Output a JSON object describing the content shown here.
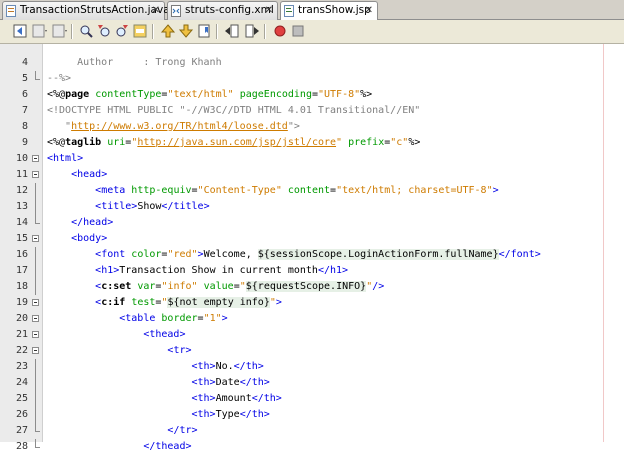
{
  "tabs": [
    {
      "label": "TransactionStrutsAction.java",
      "active": false,
      "icon": "java-file-icon"
    },
    {
      "label": "struts-config.xml",
      "active": false,
      "icon": "xml-file-icon"
    },
    {
      "label": "transShow.jsp",
      "active": true,
      "icon": "jsp-file-icon"
    }
  ],
  "toolbar": {
    "buttons": [
      "last-edit-icon",
      "back-icon",
      "forward-icon",
      "find-selection-icon",
      "find-previous-icon",
      "find-next-icon",
      "toggle-highlight-icon",
      "previous-bookmark-icon",
      "next-bookmark-icon",
      "toggle-bookmark-icon",
      "shift-left-icon",
      "shift-right-icon",
      "start-macro-icon",
      "stop-macro-icon"
    ]
  },
  "editor": {
    "lines": [
      {
        "n": "4",
        "fold": "none",
        "tokens": [
          {
            "c": "t-cmt",
            "t": "     Author     : Trong Khanh"
          }
        ]
      },
      {
        "n": "5",
        "fold": "end",
        "tokens": [
          {
            "c": "t-cmt",
            "t": "--%>"
          }
        ]
      },
      {
        "n": "6",
        "fold": "none",
        "tokens": [
          {
            "c": "t-jsp",
            "t": "<%@"
          },
          {
            "c": "t-dir",
            "t": "page"
          },
          {
            "c": "t-txt",
            "t": " "
          },
          {
            "c": "t-attr",
            "t": "contentType"
          },
          {
            "c": "t-txt",
            "t": "="
          },
          {
            "c": "t-val",
            "t": "\"text/html\""
          },
          {
            "c": "t-txt",
            "t": " "
          },
          {
            "c": "t-attr",
            "t": "pageEncoding"
          },
          {
            "c": "t-txt",
            "t": "="
          },
          {
            "c": "t-val",
            "t": "\"UTF-8\""
          },
          {
            "c": "t-jsp",
            "t": "%>"
          }
        ]
      },
      {
        "n": "7",
        "fold": "none",
        "tokens": [
          {
            "c": "t-doc",
            "t": "<!DOCTYPE HTML PUBLIC \"-//W3C//DTD HTML 4.01 Transitional//EN\""
          }
        ]
      },
      {
        "n": "8",
        "fold": "none",
        "tokens": [
          {
            "c": "t-doc",
            "t": "   \""
          },
          {
            "c": "t-url",
            "t": "http://www.w3.org/TR/html4/loose.dtd"
          },
          {
            "c": "t-doc",
            "t": "\">"
          }
        ]
      },
      {
        "n": "9",
        "fold": "none",
        "tokens": [
          {
            "c": "t-jsp",
            "t": "<%@"
          },
          {
            "c": "t-dir",
            "t": "taglib"
          },
          {
            "c": "t-txt",
            "t": " "
          },
          {
            "c": "t-attr",
            "t": "uri"
          },
          {
            "c": "t-txt",
            "t": "="
          },
          {
            "c": "t-val",
            "t": "\""
          },
          {
            "c": "t-url",
            "t": "http://java.sun.com/jsp/jstl/core"
          },
          {
            "c": "t-val",
            "t": "\""
          },
          {
            "c": "t-txt",
            "t": " "
          },
          {
            "c": "t-attr",
            "t": "prefix"
          },
          {
            "c": "t-txt",
            "t": "="
          },
          {
            "c": "t-val",
            "t": "\"c\""
          },
          {
            "c": "t-jsp",
            "t": "%>"
          }
        ]
      },
      {
        "n": "10",
        "fold": "open",
        "tokens": [
          {
            "c": "t-tag",
            "t": "<html>"
          }
        ]
      },
      {
        "n": "11",
        "fold": "open",
        "tokens": [
          {
            "c": "t-txt",
            "t": "    "
          },
          {
            "c": "t-tag",
            "t": "<head>"
          }
        ]
      },
      {
        "n": "12",
        "fold": "line",
        "tokens": [
          {
            "c": "t-txt",
            "t": "        "
          },
          {
            "c": "t-tag",
            "t": "<meta "
          },
          {
            "c": "t-attr",
            "t": "http-equiv"
          },
          {
            "c": "t-txt",
            "t": "="
          },
          {
            "c": "t-val",
            "t": "\"Content-Type\""
          },
          {
            "c": "t-txt",
            "t": " "
          },
          {
            "c": "t-attr",
            "t": "content"
          },
          {
            "c": "t-txt",
            "t": "="
          },
          {
            "c": "t-val",
            "t": "\"text/html; charset=UTF-8\""
          },
          {
            "c": "t-tag",
            "t": ">"
          }
        ]
      },
      {
        "n": "13",
        "fold": "line",
        "tokens": [
          {
            "c": "t-txt",
            "t": "        "
          },
          {
            "c": "t-tag",
            "t": "<title>"
          },
          {
            "c": "t-txt",
            "t": "Show"
          },
          {
            "c": "t-tag",
            "t": "</title>"
          }
        ]
      },
      {
        "n": "14",
        "fold": "end",
        "tokens": [
          {
            "c": "t-txt",
            "t": "    "
          },
          {
            "c": "t-tag",
            "t": "</head>"
          }
        ]
      },
      {
        "n": "15",
        "fold": "open",
        "tokens": [
          {
            "c": "t-txt",
            "t": "    "
          },
          {
            "c": "t-tag",
            "t": "<body>"
          }
        ]
      },
      {
        "n": "16",
        "fold": "line",
        "tokens": [
          {
            "c": "t-txt",
            "t": "        "
          },
          {
            "c": "t-tag",
            "t": "<font "
          },
          {
            "c": "t-attr",
            "t": "color"
          },
          {
            "c": "t-txt",
            "t": "="
          },
          {
            "c": "t-val",
            "t": "\"red\""
          },
          {
            "c": "t-tag",
            "t": ">"
          },
          {
            "c": "t-txt",
            "t": "Welcome, "
          },
          {
            "c": "t-elbg",
            "t": "${sessionScope.LoginActionForm.fullName}"
          },
          {
            "c": "t-tag",
            "t": "</font>"
          }
        ]
      },
      {
        "n": "17",
        "fold": "line",
        "tokens": [
          {
            "c": "t-txt",
            "t": "        "
          },
          {
            "c": "t-tag",
            "t": "<h1>"
          },
          {
            "c": "t-txt",
            "t": "Transaction Show in current month"
          },
          {
            "c": "t-tag",
            "t": "</h1>"
          }
        ]
      },
      {
        "n": "18",
        "fold": "line",
        "tokens": [
          {
            "c": "t-txt",
            "t": "        "
          },
          {
            "c": "t-tag",
            "t": "<"
          },
          {
            "c": "t-dir",
            "t": "c:set"
          },
          {
            "c": "t-txt",
            "t": " "
          },
          {
            "c": "t-attr",
            "t": "var"
          },
          {
            "c": "t-txt",
            "t": "="
          },
          {
            "c": "t-val",
            "t": "\"info\""
          },
          {
            "c": "t-txt",
            "t": " "
          },
          {
            "c": "t-attr",
            "t": "value"
          },
          {
            "c": "t-txt",
            "t": "="
          },
          {
            "c": "t-val",
            "t": "\""
          },
          {
            "c": "t-elbg",
            "t": "${requestScope.INFO}"
          },
          {
            "c": "t-val",
            "t": "\""
          },
          {
            "c": "t-tag",
            "t": "/>"
          }
        ]
      },
      {
        "n": "19",
        "fold": "open",
        "tokens": [
          {
            "c": "t-txt",
            "t": "        "
          },
          {
            "c": "t-tag",
            "t": "<"
          },
          {
            "c": "t-dir",
            "t": "c:if"
          },
          {
            "c": "t-txt",
            "t": " "
          },
          {
            "c": "t-attr",
            "t": "test"
          },
          {
            "c": "t-txt",
            "t": "="
          },
          {
            "c": "t-val",
            "t": "\""
          },
          {
            "c": "t-elbg",
            "t": "${not empty info}"
          },
          {
            "c": "t-val",
            "t": "\""
          },
          {
            "c": "t-tag",
            "t": ">"
          }
        ]
      },
      {
        "n": "20",
        "fold": "open",
        "tokens": [
          {
            "c": "t-txt",
            "t": "            "
          },
          {
            "c": "t-tag",
            "t": "<table "
          },
          {
            "c": "t-attr",
            "t": "border"
          },
          {
            "c": "t-txt",
            "t": "="
          },
          {
            "c": "t-val",
            "t": "\"1\""
          },
          {
            "c": "t-tag",
            "t": ">"
          }
        ]
      },
      {
        "n": "21",
        "fold": "open",
        "tokens": [
          {
            "c": "t-txt",
            "t": "                "
          },
          {
            "c": "t-tag",
            "t": "<thead>"
          }
        ]
      },
      {
        "n": "22",
        "fold": "open",
        "tokens": [
          {
            "c": "t-txt",
            "t": "                    "
          },
          {
            "c": "t-tag",
            "t": "<tr>"
          }
        ]
      },
      {
        "n": "23",
        "fold": "line",
        "tokens": [
          {
            "c": "t-txt",
            "t": "                        "
          },
          {
            "c": "t-tag",
            "t": "<th>"
          },
          {
            "c": "t-txt",
            "t": "No."
          },
          {
            "c": "t-tag",
            "t": "</th>"
          }
        ]
      },
      {
        "n": "24",
        "fold": "line",
        "tokens": [
          {
            "c": "t-txt",
            "t": "                        "
          },
          {
            "c": "t-tag",
            "t": "<th>"
          },
          {
            "c": "t-txt",
            "t": "Date"
          },
          {
            "c": "t-tag",
            "t": "</th>"
          }
        ]
      },
      {
        "n": "25",
        "fold": "line",
        "tokens": [
          {
            "c": "t-txt",
            "t": "                        "
          },
          {
            "c": "t-tag",
            "t": "<th>"
          },
          {
            "c": "t-txt",
            "t": "Amount"
          },
          {
            "c": "t-tag",
            "t": "</th>"
          }
        ]
      },
      {
        "n": "26",
        "fold": "line",
        "tokens": [
          {
            "c": "t-txt",
            "t": "                        "
          },
          {
            "c": "t-tag",
            "t": "<th>"
          },
          {
            "c": "t-txt",
            "t": "Type"
          },
          {
            "c": "t-tag",
            "t": "</th>"
          }
        ]
      },
      {
        "n": "27",
        "fold": "end",
        "tokens": [
          {
            "c": "t-txt",
            "t": "                    "
          },
          {
            "c": "t-tag",
            "t": "</tr>"
          }
        ]
      },
      {
        "n": "28",
        "fold": "end",
        "tokens": [
          {
            "c": "t-txt",
            "t": "                "
          },
          {
            "c": "t-tag",
            "t": "</thead>"
          }
        ]
      }
    ]
  }
}
